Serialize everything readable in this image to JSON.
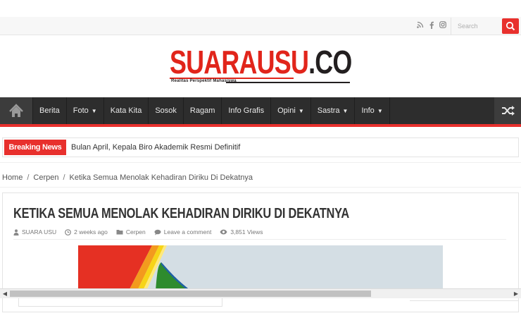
{
  "topbar": {
    "social_icons": [
      "rss-icon",
      "facebook-icon",
      "instagram-icon"
    ],
    "search_placeholder": "Search"
  },
  "logo": {
    "part_red": "SUARAUSU",
    "part_dark": ".CO",
    "tagline": "Realitas Perspektif Mahasiswa"
  },
  "nav": {
    "items": [
      {
        "label": "Berita",
        "dropdown": false
      },
      {
        "label": "Foto",
        "dropdown": true
      },
      {
        "label": "Kata Kita",
        "dropdown": false
      },
      {
        "label": "Sosok",
        "dropdown": false
      },
      {
        "label": "Ragam",
        "dropdown": false
      },
      {
        "label": "Info Grafis",
        "dropdown": false
      },
      {
        "label": "Opini",
        "dropdown": true
      },
      {
        "label": "Sastra",
        "dropdown": true
      },
      {
        "label": "Info",
        "dropdown": true
      }
    ]
  },
  "breaking": {
    "label": "Breaking News",
    "headline": "Bulan April, Kepala Biro Akademik Resmi Definitif"
  },
  "breadcrumb": {
    "home": "Home",
    "category": "Cerpen",
    "current": "Ketika Semua Menolak Kehadiran Diriku Di Dekatnya",
    "separator": "/"
  },
  "post": {
    "title": "KETIKA SEMUA MENOLAK KEHADIRAN DIRIKU DI DEKATNYA",
    "author": "SUARA USU",
    "time": "2 weeks ago",
    "category": "Cerpen",
    "comment": "Leave a comment",
    "views": "3,851 Views"
  },
  "colors": {
    "accent": "#e8302d",
    "nav_bg": "#2d2d2d"
  }
}
